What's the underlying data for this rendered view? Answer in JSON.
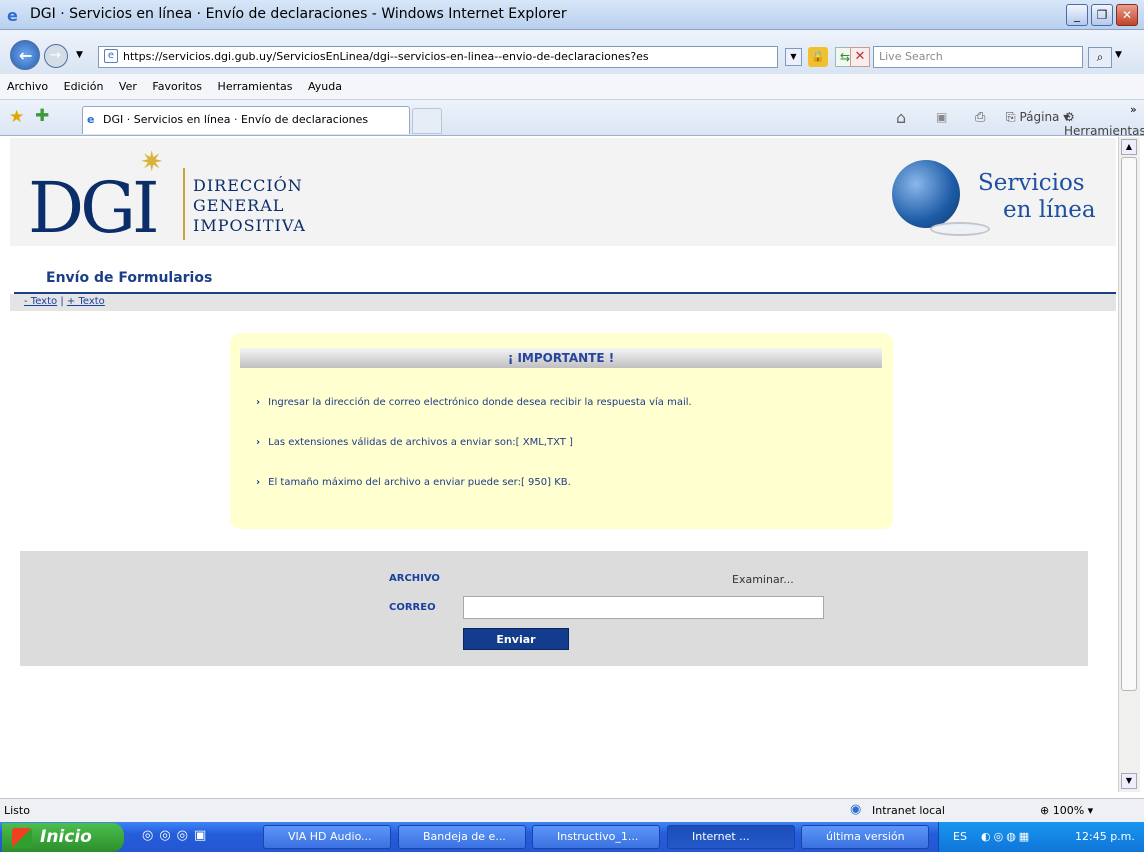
{
  "window": {
    "title": "DGI · Servicios en línea · Envío de declaraciones - Windows Internet Explorer"
  },
  "nav": {
    "url": "https://servicios.dgi.gub.uy/ServiciosEnLinea/dgi--servicios-en-linea--envio-de-declaraciones?es",
    "search_placeholder": "Live Search"
  },
  "menu": [
    "Archivo",
    "Edición",
    "Ver",
    "Favoritos",
    "Herramientas",
    "Ayuda"
  ],
  "tabs": {
    "active": "DGI · Servicios en línea · Envío de declaraciones"
  },
  "cmdbar": {
    "page": "Página",
    "tools": "Herramientas"
  },
  "header": {
    "logo": "DGI",
    "line1": "DIRECCIÓN",
    "line2": "GENERAL",
    "line3": "IMPOSITIVA",
    "svc1": "Servicios",
    "svc2": "en línea"
  },
  "page": {
    "title": "Envío de Formularios",
    "text_minus": "- Texto",
    "sep": "|",
    "text_plus": "+ Texto"
  },
  "important": {
    "heading": "¡ IMPORTANTE !",
    "items": [
      "Ingresar la dirección de correo electrónico donde desea recibir la respuesta vía mail.",
      "Las extensiones válidas de archivos a enviar son:[ XML,TXT ]",
      "El tamaño máximo del archivo a enviar puede ser:[ 950] KB."
    ]
  },
  "form": {
    "archivo_label": "ARCHIVO",
    "browse": "Examinar...",
    "correo_label": "CORREO",
    "correo_value": "",
    "submit": "Enviar"
  },
  "status": {
    "text": "Listo",
    "zone": "Intranet local",
    "zoom": "100%"
  },
  "taskbar": {
    "start": "Inicio",
    "items": [
      "VIA HD Audio...",
      "Bandeja de e...",
      "Instructivo_1...",
      "Internet ...",
      "última versión"
    ],
    "lang": "ES",
    "clock": "12:45 p.m."
  }
}
